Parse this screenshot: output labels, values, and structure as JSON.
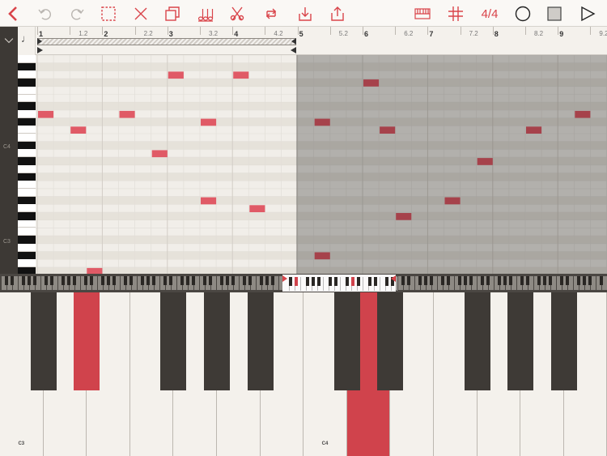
{
  "toolbar": {
    "time_signature": "4/4",
    "accent": "#d9444a",
    "icons": [
      "back-chevron-icon",
      "undo-icon",
      "redo-icon",
      "select-icon",
      "delete-icon",
      "copy-icon",
      "quantize-icon",
      "split-icon",
      "loop-icon",
      "import-icon",
      "share-icon",
      "piano-view-icon",
      "grid-icon",
      "time-signature",
      "record-icon",
      "stop-icon",
      "play-icon"
    ]
  },
  "ruler": {
    "note_length_symbol": "♩",
    "labels": [
      {
        "text": "1",
        "bar": true,
        "beat": 0
      },
      {
        "text": "1.2",
        "bar": false,
        "beat": 2
      },
      {
        "text": "2",
        "bar": true,
        "beat": 4
      },
      {
        "text": "2.2",
        "bar": false,
        "beat": 6
      },
      {
        "text": "3",
        "bar": true,
        "beat": 8
      },
      {
        "text": "3.2",
        "bar": false,
        "beat": 10
      },
      {
        "text": "4",
        "bar": true,
        "beat": 12
      },
      {
        "text": "4.2",
        "bar": false,
        "beat": 14
      },
      {
        "text": "5",
        "bar": true,
        "beat": 16
      },
      {
        "text": "5.2",
        "bar": false,
        "beat": 18
      },
      {
        "text": "6",
        "bar": true,
        "beat": 20
      },
      {
        "text": "6.2",
        "bar": false,
        "beat": 22
      },
      {
        "text": "7",
        "bar": true,
        "beat": 24
      },
      {
        "text": "7.2",
        "bar": false,
        "beat": 26
      },
      {
        "text": "8",
        "bar": true,
        "beat": 28
      },
      {
        "text": "8.2",
        "bar": false,
        "beat": 30
      },
      {
        "text": "9",
        "bar": true,
        "beat": 32
      },
      {
        "text": "9.2",
        "bar": false,
        "beat": 34
      }
    ]
  },
  "piano_roll": {
    "octave_labels": [
      "C4",
      "C3"
    ],
    "active_key_color": "#d0434c",
    "notes": [
      {
        "beat": 0,
        "pitch": 62
      },
      {
        "beat": 2,
        "pitch": 60
      },
      {
        "beat": 5,
        "pitch": 62
      },
      {
        "beat": 7,
        "pitch": 57
      },
      {
        "beat": 8,
        "pitch": 67
      },
      {
        "beat": 10,
        "pitch": 61
      },
      {
        "beat": 10,
        "pitch": 51
      },
      {
        "beat": 12,
        "pitch": 67
      },
      {
        "beat": 13,
        "pitch": 50
      },
      {
        "beat": 17,
        "pitch": 61
      },
      {
        "beat": 17,
        "pitch": 44
      },
      {
        "beat": 20,
        "pitch": 66
      },
      {
        "beat": 21,
        "pitch": 60
      },
      {
        "beat": 22,
        "pitch": 49
      },
      {
        "beat": 25,
        "pitch": 51
      },
      {
        "beat": 27,
        "pitch": 56
      },
      {
        "beat": 30,
        "pitch": 60
      },
      {
        "beat": 33,
        "pitch": 62
      },
      {
        "beat": 3,
        "pitch": 42
      }
    ]
  },
  "keyboard": {
    "labels": [
      "C3",
      "C4"
    ],
    "active_white_keys": [
      8
    ],
    "active_black_keys": [
      1
    ]
  }
}
